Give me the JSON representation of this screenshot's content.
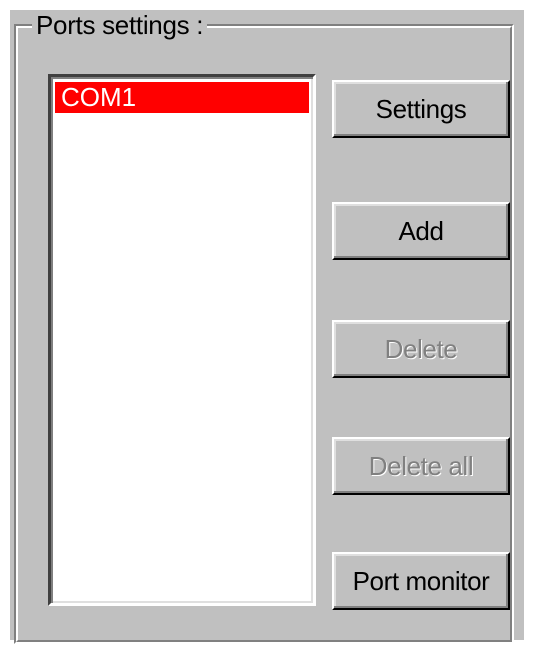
{
  "group": {
    "title": "Ports settings :"
  },
  "ports_list": {
    "items": [
      {
        "label": "COM1",
        "selected": true
      }
    ],
    "selection_color": "#ff0000"
  },
  "buttons": {
    "settings": {
      "label": "Settings",
      "enabled": true
    },
    "add": {
      "label": "Add",
      "enabled": true
    },
    "delete": {
      "label": "Delete",
      "enabled": false
    },
    "delete_all": {
      "label": "Delete all",
      "enabled": false
    },
    "port_monitor": {
      "label": "Port monitor",
      "enabled": true
    }
  }
}
